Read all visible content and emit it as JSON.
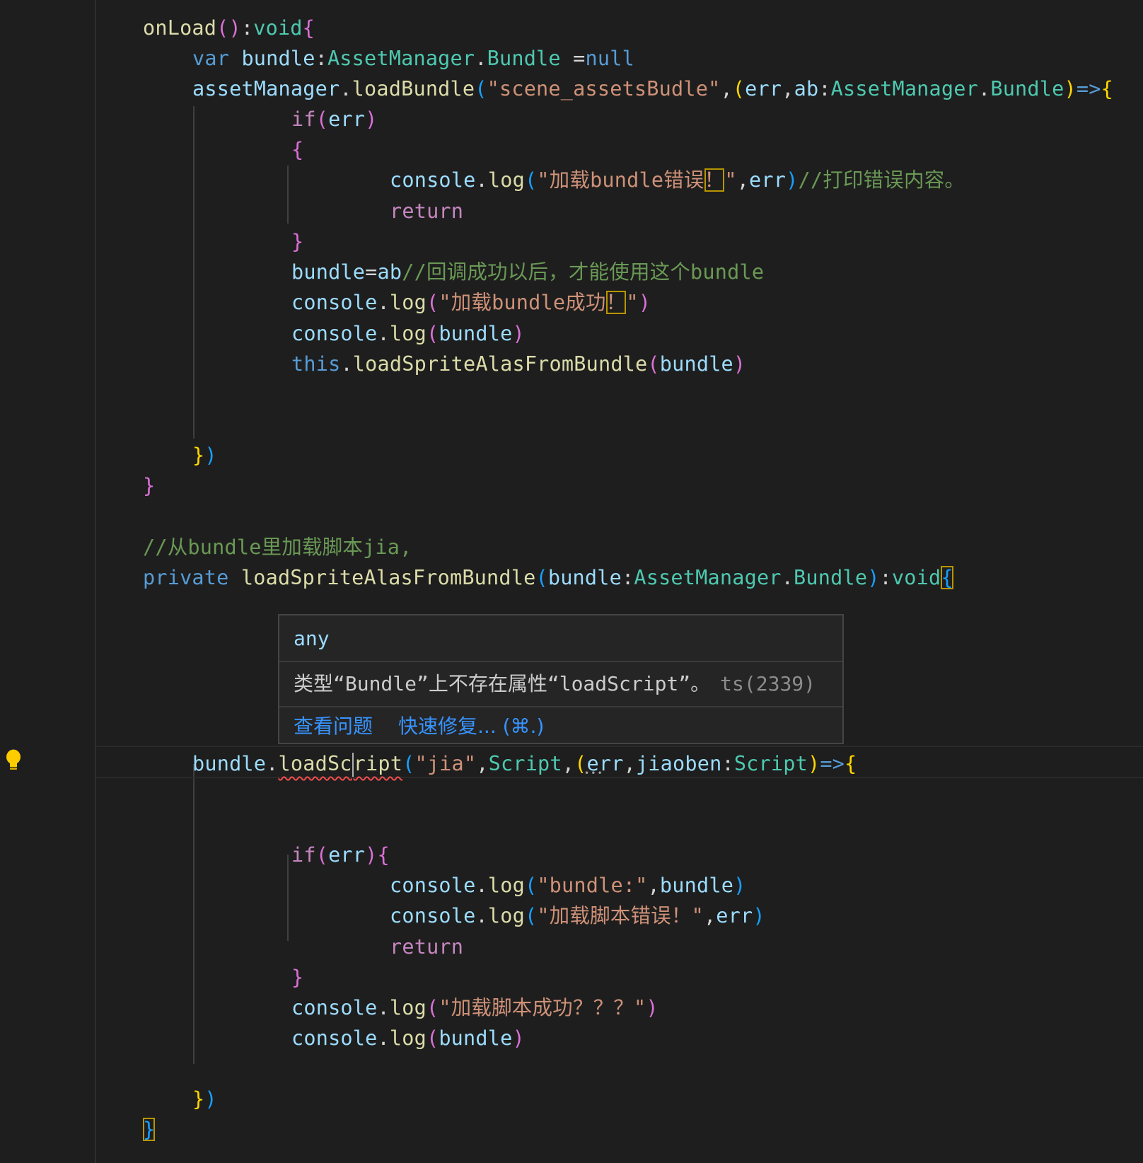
{
  "editor": {
    "lines": [
      [
        {
          "t": "onLoad",
          "c": "fn"
        },
        {
          "t": "()",
          "c": "b2"
        },
        {
          "t": ":",
          "c": "pun"
        },
        {
          "t": "void",
          "c": "typ"
        },
        {
          "t": "{",
          "c": "b2"
        }
      ],
      [
        {
          "t": "var",
          "c": "kw"
        },
        {
          "t": " ",
          "c": "pun"
        },
        {
          "t": "bundle",
          "c": "var"
        },
        {
          "t": ":",
          "c": "pun"
        },
        {
          "t": "AssetManager",
          "c": "typ"
        },
        {
          "t": ".",
          "c": "pun"
        },
        {
          "t": "Bundle",
          "c": "typ"
        },
        {
          "t": " =",
          "c": "pun"
        },
        {
          "t": "null",
          "c": "kw"
        }
      ],
      [
        {
          "t": "assetManager",
          "c": "var"
        },
        {
          "t": ".",
          "c": "pun"
        },
        {
          "t": "loadBundle",
          "c": "fn"
        },
        {
          "t": "(",
          "c": "b3"
        },
        {
          "t": "\"scene_assetsBudle\"",
          "c": "str"
        },
        {
          "t": ",",
          "c": "pun"
        },
        {
          "t": "(",
          "c": "b1"
        },
        {
          "t": "err",
          "c": "var"
        },
        {
          "t": ",",
          "c": "pun"
        },
        {
          "t": "ab",
          "c": "var"
        },
        {
          "t": ":",
          "c": "pun"
        },
        {
          "t": "AssetManager",
          "c": "typ"
        },
        {
          "t": ".",
          "c": "pun"
        },
        {
          "t": "Bundle",
          "c": "typ"
        },
        {
          "t": ")",
          "c": "b1"
        },
        {
          "t": "=>",
          "c": "kw"
        },
        {
          "t": "{",
          "c": "b1"
        }
      ],
      [
        {
          "t": "if",
          "c": "ctl"
        },
        {
          "t": "(",
          "c": "b2"
        },
        {
          "t": "err",
          "c": "var"
        },
        {
          "t": ")",
          "c": "b2"
        }
      ],
      [
        {
          "t": "{",
          "c": "b2"
        }
      ],
      [
        {
          "t": "console",
          "c": "var"
        },
        {
          "t": ".",
          "c": "pun"
        },
        {
          "t": "log",
          "c": "fn"
        },
        {
          "t": "(",
          "c": "b3"
        },
        {
          "t": "\"加载bundle错误",
          "c": "str"
        },
        {
          "t": "！",
          "c": "str hl"
        },
        {
          "t": "\"",
          "c": "str"
        },
        {
          "t": ",",
          "c": "pun"
        },
        {
          "t": "err",
          "c": "var"
        },
        {
          "t": ")",
          "c": "b3"
        },
        {
          "t": "//打印错误内容。",
          "c": "cmt"
        }
      ],
      [
        {
          "t": "return",
          "c": "ctl"
        }
      ],
      [
        {
          "t": "}",
          "c": "b2"
        }
      ],
      [
        {
          "t": "bundle",
          "c": "var"
        },
        {
          "t": "=",
          "c": "pun"
        },
        {
          "t": "ab",
          "c": "var"
        },
        {
          "t": "//回调成功以后，才能使用这个bundle",
          "c": "cmt"
        }
      ],
      [
        {
          "t": "console",
          "c": "var"
        },
        {
          "t": ".",
          "c": "pun"
        },
        {
          "t": "log",
          "c": "fn"
        },
        {
          "t": "(",
          "c": "b2"
        },
        {
          "t": "\"加载bundle成功",
          "c": "str"
        },
        {
          "t": "！",
          "c": "str hl"
        },
        {
          "t": "\"",
          "c": "str"
        },
        {
          "t": ")",
          "c": "b2"
        }
      ],
      [
        {
          "t": "console",
          "c": "var"
        },
        {
          "t": ".",
          "c": "pun"
        },
        {
          "t": "log",
          "c": "fn"
        },
        {
          "t": "(",
          "c": "b2"
        },
        {
          "t": "bundle",
          "c": "var"
        },
        {
          "t": ")",
          "c": "b2"
        }
      ],
      [
        {
          "t": "this",
          "c": "kw"
        },
        {
          "t": ".",
          "c": "pun"
        },
        {
          "t": "loadSpriteAlasFromBundle",
          "c": "fn"
        },
        {
          "t": "(",
          "c": "b2"
        },
        {
          "t": "bundle",
          "c": "var"
        },
        {
          "t": ")",
          "c": "b2"
        }
      ],
      [],
      [],
      [
        {
          "t": "}",
          "c": "b1"
        },
        {
          "t": ")",
          "c": "b3"
        }
      ],
      [
        {
          "t": "}",
          "c": "b2"
        }
      ],
      [],
      [
        {
          "t": "//从bundle里加载脚本jia,",
          "c": "cmt"
        }
      ],
      [
        {
          "t": "private",
          "c": "kw"
        },
        {
          "t": " ",
          "c": "pun"
        },
        {
          "t": "loadSpriteAlasFromBundle",
          "c": "fn"
        },
        {
          "t": "(",
          "c": "b3"
        },
        {
          "t": "bundle",
          "c": "var"
        },
        {
          "t": ":",
          "c": "pun"
        },
        {
          "t": "AssetManager",
          "c": "typ"
        },
        {
          "t": ".",
          "c": "pun"
        },
        {
          "t": "Bundle",
          "c": "typ"
        },
        {
          "t": ")",
          "c": "b3"
        },
        {
          "t": ":",
          "c": "pun"
        },
        {
          "t": "void",
          "c": "typ"
        },
        {
          "t": "{",
          "c": "b3 hl"
        }
      ],
      [],
      [],
      [],
      [],
      [
        {
          "t": "bundle",
          "c": "var"
        },
        {
          "t": ".",
          "c": "pun"
        },
        {
          "t": "loadSc",
          "c": "fn squiggle"
        },
        {
          "t": "|",
          "c": "cursor"
        },
        {
          "t": "ript",
          "c": "fn squiggle"
        },
        {
          "t": "(",
          "c": "b3"
        },
        {
          "t": "\"jia\"",
          "c": "str"
        },
        {
          "t": ",",
          "c": "pun"
        },
        {
          "t": "Script",
          "c": "typ"
        },
        {
          "t": ",",
          "c": "pun"
        },
        {
          "t": "(",
          "c": "b1"
        },
        {
          "t": "err",
          "c": "var"
        },
        {
          "t": ",",
          "c": "pun"
        },
        {
          "t": "jiaoben",
          "c": "var"
        },
        {
          "t": ":",
          "c": "pun"
        },
        {
          "t": "Script",
          "c": "typ"
        },
        {
          "t": ")",
          "c": "b1"
        },
        {
          "t": "=>",
          "c": "kw"
        },
        {
          "t": "{",
          "c": "b1"
        }
      ],
      [],
      [],
      [
        {
          "t": "if",
          "c": "ctl"
        },
        {
          "t": "(",
          "c": "b2"
        },
        {
          "t": "err",
          "c": "var"
        },
        {
          "t": ")",
          "c": "b2"
        },
        {
          "t": "{",
          "c": "b2"
        }
      ],
      [
        {
          "t": "console",
          "c": "var"
        },
        {
          "t": ".",
          "c": "pun"
        },
        {
          "t": "log",
          "c": "fn"
        },
        {
          "t": "(",
          "c": "b3"
        },
        {
          "t": "\"bundle:\"",
          "c": "str"
        },
        {
          "t": ",",
          "c": "pun"
        },
        {
          "t": "bundle",
          "c": "var"
        },
        {
          "t": ")",
          "c": "b3"
        }
      ],
      [
        {
          "t": "console",
          "c": "var"
        },
        {
          "t": ".",
          "c": "pun"
        },
        {
          "t": "log",
          "c": "fn"
        },
        {
          "t": "(",
          "c": "b3"
        },
        {
          "t": "\"加载脚本错误！\"",
          "c": "str"
        },
        {
          "t": ",",
          "c": "pun"
        },
        {
          "t": "err",
          "c": "var"
        },
        {
          "t": ")",
          "c": "b3"
        }
      ],
      [
        {
          "t": "return",
          "c": "ctl"
        }
      ],
      [
        {
          "t": "}",
          "c": "b2"
        }
      ],
      [
        {
          "t": "console",
          "c": "var"
        },
        {
          "t": ".",
          "c": "pun"
        },
        {
          "t": "log",
          "c": "fn"
        },
        {
          "t": "(",
          "c": "b2"
        },
        {
          "t": "\"加载脚本成功？？？\"",
          "c": "str"
        },
        {
          "t": ")",
          "c": "b2"
        }
      ],
      [
        {
          "t": "console",
          "c": "var"
        },
        {
          "t": ".",
          "c": "pun"
        },
        {
          "t": "log",
          "c": "fn"
        },
        {
          "t": "(",
          "c": "b2"
        },
        {
          "t": "bundle",
          "c": "var"
        },
        {
          "t": ")",
          "c": "b2"
        }
      ],
      [],
      [],
      [
        {
          "t": "}",
          "c": "b1"
        },
        {
          "t": ")",
          "c": "b3"
        }
      ],
      [
        {
          "t": "}",
          "c": "b3 hl"
        }
      ]
    ]
  },
  "hover": {
    "signature": "any",
    "message": "类型“Bundle”上不存在属性“loadScript”。",
    "error_code": "ts(2339)",
    "actions": {
      "view_problem": "查看问题",
      "quick_fix": "快速修复... (⌘.)"
    }
  },
  "lightbulb": {
    "icon": "lightbulb-icon",
    "color": "#ffcc00"
  },
  "colors": {
    "background": "#1e1e1e",
    "function": "#dcdcaa",
    "keyword": "#569cd6",
    "control": "#c586c0",
    "variable": "#9cdcfe",
    "type": "#4ec9b0",
    "string": "#ce9178",
    "comment": "#6a9955",
    "error": "#f14c4c",
    "link": "#3794ff"
  }
}
